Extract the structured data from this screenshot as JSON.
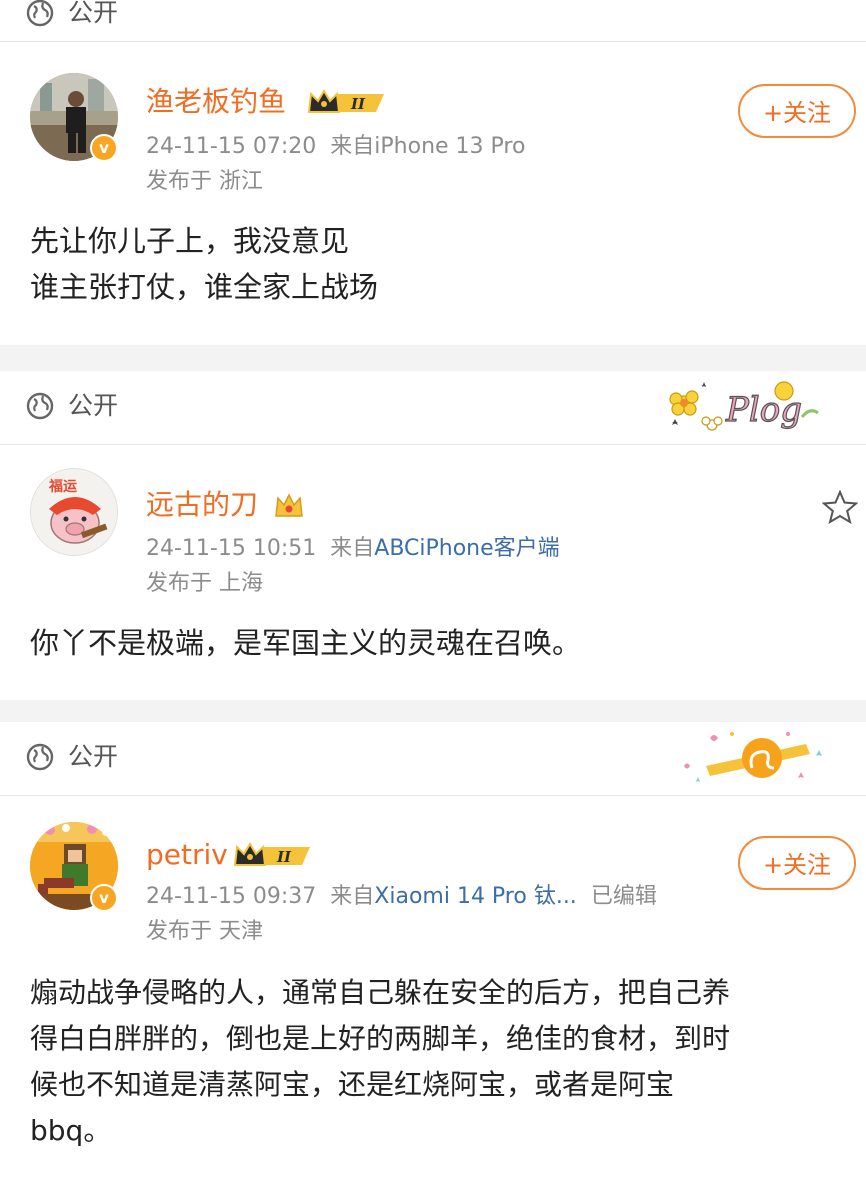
{
  "posts": [
    {
      "visibility": "公开",
      "username": "渔老板钓鱼",
      "level_badge": "II",
      "time": "24-11-15 07:20",
      "from_label": "来自",
      "source": "iPhone 13 Pro",
      "edited": "",
      "location": "发布于 浙江",
      "follow_label": "+关注",
      "lines": [
        "先让你儿子上，我没意见",
        "谁主张打仗，谁全家上战场"
      ]
    },
    {
      "visibility": "公开",
      "username": "远古的刀",
      "time": "24-11-15 10:51",
      "from_label": "来自",
      "source": "ABCiPhone客户端",
      "location": "发布于 上海",
      "lines": [
        "你丫不是极端，是军国主义的灵魂在召唤。"
      ],
      "sticker_text": "Plog"
    },
    {
      "visibility": "公开",
      "username": "petriv",
      "level_badge": "II",
      "time": "24-11-15 09:37",
      "from_label": "来自",
      "source": "Xiaomi 14 Pro 钛...",
      "edited": "已编辑",
      "location": "发布于 天津",
      "follow_label": "+关注",
      "lines": [
        "煽动战争侵略的人，通常自己躲在安全的后方，把自己养",
        "得白白胖胖的，倒也是上好的两脚羊，绝佳的食材，到时",
        "候也不知道是清蒸阿宝，还是红烧阿宝，或者是阿宝",
        "bbq。"
      ]
    }
  ],
  "icons": {
    "globe": "globe-icon",
    "star": "star-icon",
    "verified": "verified-badge-icon",
    "crown": "crown-icon"
  },
  "colors": {
    "username": "#f26c22",
    "source_link": "#3b6ea8",
    "meta": "#8c8c8c",
    "follow_border": "#f28a3a"
  }
}
